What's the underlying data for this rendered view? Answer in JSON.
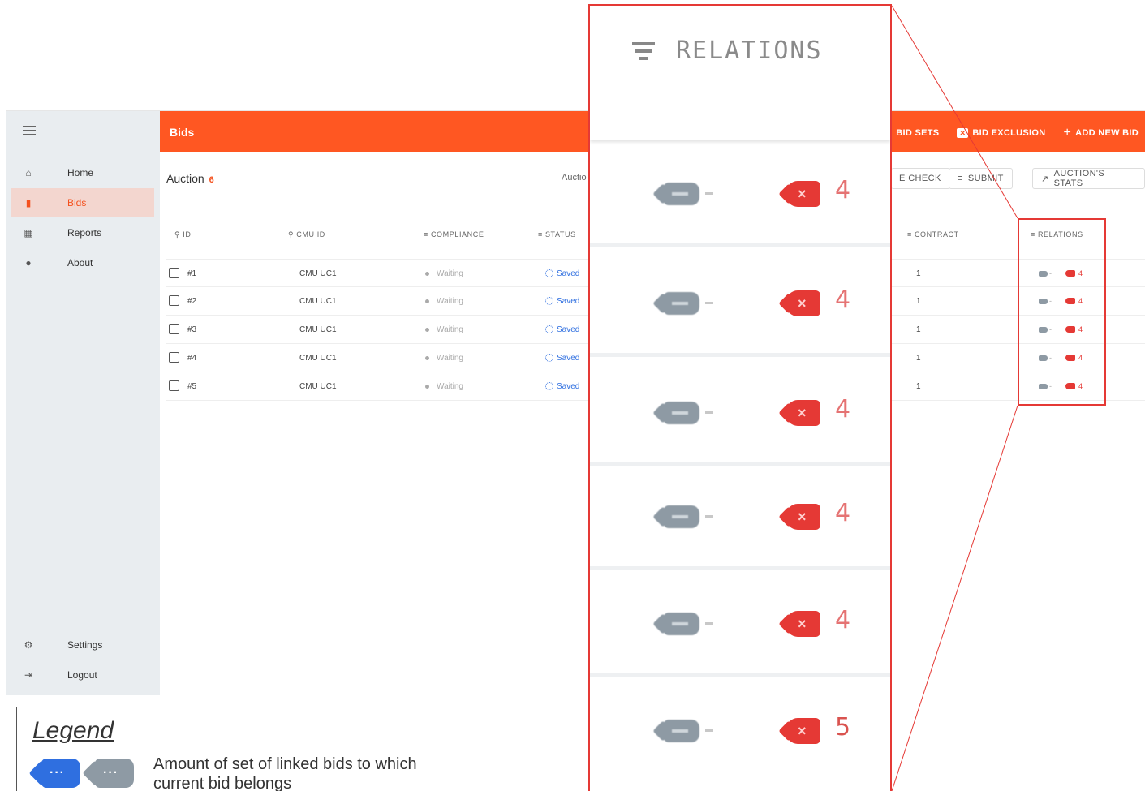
{
  "sidebar": {
    "items": [
      {
        "label": "Home",
        "icon": "home-icon"
      },
      {
        "label": "Bids",
        "icon": "bids-icon"
      },
      {
        "label": "Reports",
        "icon": "reports-icon"
      },
      {
        "label": "About",
        "icon": "info-icon"
      }
    ],
    "bottom_items": [
      {
        "label": "Settings",
        "icon": "gear-icon"
      },
      {
        "label": "Logout",
        "icon": "logout-icon"
      }
    ]
  },
  "topbar": {
    "title": "Bids",
    "actions": [
      "BID SETS",
      "BID EXCLUSION",
      "ADD NEW BID"
    ]
  },
  "content": {
    "title": "Auction",
    "count": "6",
    "subtitle_fragment": "Auctio",
    "buttons": [
      "E CHECK",
      "SUBMIT",
      "AUCTION'S STATS"
    ]
  },
  "table": {
    "headers": [
      "ID",
      "CMU ID",
      "COMPLIANCE",
      "STATUS",
      "CONTRACT",
      "RELATIONS"
    ],
    "rows": [
      {
        "id": "#1",
        "cmu": "CMU UC1",
        "compliance": "Waiting",
        "status": "Saved",
        "contract": "1",
        "relations_count": "4"
      },
      {
        "id": "#2",
        "cmu": "CMU UC1",
        "compliance": "Waiting",
        "status": "Saved",
        "contract": "1",
        "relations_count": "4"
      },
      {
        "id": "#3",
        "cmu": "CMU UC1",
        "compliance": "Waiting",
        "status": "Saved",
        "contract": "1",
        "relations_count": "4"
      },
      {
        "id": "#4",
        "cmu": "CMU UC1",
        "compliance": "Waiting",
        "status": "Saved",
        "contract": "1",
        "relations_count": "4"
      },
      {
        "id": "#5",
        "cmu": "CMU UC1",
        "compliance": "Waiting",
        "status": "Saved",
        "contract": "1",
        "relations_count": "4"
      }
    ]
  },
  "zoom": {
    "title": "RELATIONS",
    "counts": [
      "4",
      "4",
      "4",
      "4",
      "4",
      "5"
    ]
  },
  "legend": {
    "title": "Legend",
    "text": "Amount of set of linked bids to which current bid belongs",
    "colors": {
      "active": "#2f6fe0",
      "inactive": "#8e9aa4"
    }
  },
  "colors": {
    "brand": "#ff5722",
    "highlight": "#e53935"
  }
}
